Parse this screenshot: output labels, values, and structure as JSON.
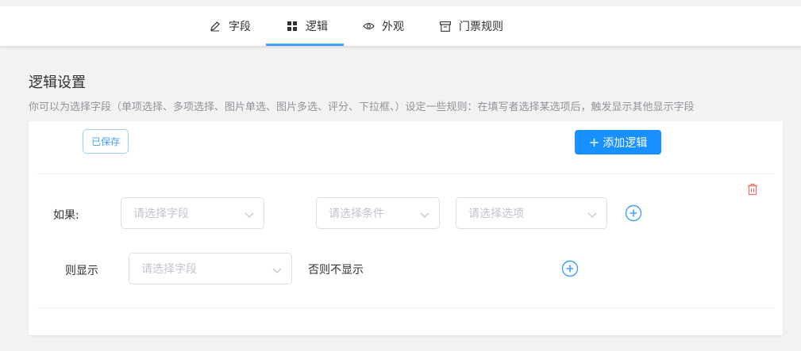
{
  "tabs": [
    {
      "label": "字段",
      "icon": "pencil-icon",
      "active": false
    },
    {
      "label": "逻辑",
      "icon": "grid-icon",
      "active": true
    },
    {
      "label": "外观",
      "icon": "eye-icon",
      "active": false
    },
    {
      "label": "门票规则",
      "icon": "archive-box-icon",
      "active": false
    }
  ],
  "page": {
    "title": "逻辑设置",
    "description": "你可以为选择字段（单项选择、多项选择、图片单选、图片多选、评分、下拉框、）设定一些规则：在填写者选择某选项后，触发显示其他显示字段"
  },
  "panel": {
    "saved_label": "已保存",
    "add_label": "添加逻辑",
    "rule": {
      "if_label": "如果:",
      "field_placeholder": "请选择字段",
      "condition_placeholder": "请选择条件",
      "option_placeholder": "请选择选项",
      "then_label": "则显示",
      "then_placeholder": "请选择字段",
      "else_label": "否则不显示"
    }
  },
  "colors": {
    "accent": "#1890ff",
    "tab_underline": "#409eff",
    "delete": "#f56c6c"
  }
}
